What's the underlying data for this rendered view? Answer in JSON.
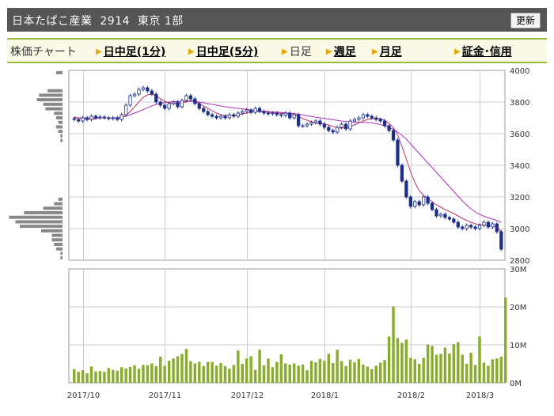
{
  "header": {
    "title": "日本たばこ産業  2914  東京 1部",
    "refresh_label": "更新"
  },
  "tabs": [
    {
      "label": "株価チャート",
      "style": "plain"
    },
    {
      "label": "日中足(1分)",
      "style": "link"
    },
    {
      "label": "日中足(5分)",
      "style": "link"
    },
    {
      "label": "日足",
      "style": "current"
    },
    {
      "label": "週足",
      "style": "link"
    },
    {
      "label": "月足",
      "style": "link"
    },
    {
      "label": "証金･信用",
      "style": "link"
    }
  ],
  "colors": {
    "up_candle": "#ffffff",
    "down_candle": "#1a2f8a",
    "ma_short": "#c0306a",
    "ma_long": "#b030c0",
    "volume_bar": "#8aac2c",
    "volume_profile": "#888888",
    "grid": "#cccccc"
  },
  "chart_data": [
    {
      "type": "candlestick",
      "title": "",
      "ylim": [
        2800,
        4000
      ],
      "y_ticks": [
        "4000",
        "3800",
        "3600",
        "3400",
        "3200",
        "3000",
        "2800"
      ],
      "x_ticks": [
        "2017/10",
        "2017/11",
        "2017/12",
        "2018/1",
        "2018/2",
        "2018/3"
      ],
      "close": [
        3690,
        3680,
        3700,
        3690,
        3710,
        3700,
        3705,
        3700,
        3695,
        3700,
        3690,
        3720,
        3780,
        3840,
        3850,
        3880,
        3890,
        3870,
        3850,
        3800,
        3780,
        3760,
        3790,
        3800,
        3770,
        3810,
        3840,
        3820,
        3790,
        3760,
        3740,
        3720,
        3710,
        3700,
        3710,
        3700,
        3720,
        3710,
        3730,
        3740,
        3750,
        3735,
        3760,
        3740,
        3730,
        3725,
        3730,
        3720,
        3715,
        3730,
        3700,
        3720,
        3650,
        3650,
        3660,
        3670,
        3680,
        3660,
        3640,
        3620,
        3610,
        3640,
        3660,
        3630,
        3680,
        3690,
        3700,
        3720,
        3710,
        3700,
        3690,
        3680,
        3650,
        3620,
        3560,
        3400,
        3300,
        3200,
        3140,
        3170,
        3150,
        3200,
        3160,
        3120,
        3080,
        3090,
        3070,
        3060,
        3040,
        3010,
        3000,
        3020,
        3010,
        3000,
        3020,
        3040,
        3010,
        3030,
        2980,
        2870
      ],
      "ma_short": [
        3705,
        3700,
        3695,
        3690,
        3690,
        3695,
        3700,
        3700,
        3700,
        3700,
        3698,
        3700,
        3715,
        3740,
        3770,
        3800,
        3830,
        3845,
        3850,
        3840,
        3820,
        3805,
        3795,
        3790,
        3790,
        3795,
        3800,
        3810,
        3805,
        3790,
        3775,
        3760,
        3745,
        3730,
        3720,
        3715,
        3715,
        3715,
        3720,
        3725,
        3730,
        3735,
        3740,
        3740,
        3738,
        3735,
        3733,
        3730,
        3728,
        3727,
        3722,
        3720,
        3710,
        3695,
        3685,
        3675,
        3668,
        3665,
        3662,
        3655,
        3645,
        3638,
        3635,
        3638,
        3645,
        3655,
        3668,
        3680,
        3690,
        3695,
        3698,
        3695,
        3685,
        3665,
        3640,
        3590,
        3520,
        3440,
        3360,
        3290,
        3240,
        3210,
        3190,
        3170,
        3150,
        3135,
        3120,
        3108,
        3095,
        3080,
        3065,
        3052,
        3040,
        3030,
        3025,
        3022,
        3020,
        3018,
        3010,
        2980
      ],
      "ma_long": [
        3700,
        3700,
        3700,
        3700,
        3700,
        3700,
        3700,
        3700,
        3700,
        3700,
        3700,
        3705,
        3710,
        3720,
        3730,
        3740,
        3752,
        3764,
        3776,
        3785,
        3792,
        3797,
        3800,
        3802,
        3803,
        3804,
        3805,
        3805,
        3804,
        3800,
        3795,
        3790,
        3785,
        3780,
        3775,
        3770,
        3767,
        3763,
        3760,
        3757,
        3754,
        3750,
        3747,
        3744,
        3742,
        3740,
        3738,
        3736,
        3734,
        3732,
        3730,
        3727,
        3723,
        3719,
        3714,
        3709,
        3704,
        3700,
        3696,
        3692,
        3688,
        3684,
        3680,
        3677,
        3675,
        3673,
        3672,
        3671,
        3670,
        3668,
        3664,
        3658,
        3650,
        3640,
        3628,
        3610,
        3590,
        3565,
        3535,
        3505,
        3475,
        3445,
        3415,
        3385,
        3355,
        3325,
        3295,
        3265,
        3235,
        3205,
        3175,
        3148,
        3125,
        3105,
        3090,
        3078,
        3068,
        3060,
        3052,
        3040
      ],
      "volume_profile": [
        1,
        1,
        3,
        4,
        5,
        5,
        10,
        20,
        22,
        25,
        18,
        9,
        4,
        2,
        0,
        0,
        0,
        0,
        0,
        0,
        0,
        0,
        0,
        0,
        0,
        0,
        1,
        1,
        2,
        3,
        2,
        3,
        4,
        8,
        9,
        12,
        11,
        7,
        0,
        0,
        0,
        3
      ]
    },
    {
      "type": "bar",
      "title": "",
      "ylim": [
        0,
        30
      ],
      "y_ticks": [
        "30M",
        "20M",
        "10M",
        "0M"
      ],
      "x_ticks": [
        "2017/10",
        "2017/11",
        "2017/12",
        "2018/1",
        "2018/2",
        "2018/3"
      ],
      "values": [
        3.6,
        2.9,
        3.3,
        2.5,
        4.3,
        3.0,
        3.1,
        2.9,
        3.9,
        3.4,
        3.2,
        4.1,
        3.8,
        4.2,
        4.6,
        3.7,
        4.7,
        4.6,
        5.1,
        4.4,
        6.9,
        4.5,
        5.8,
        6.4,
        7.0,
        7.6,
        8.9,
        5.7,
        5.1,
        5.5,
        4.4,
        5.5,
        5.5,
        4.5,
        5.2,
        4.4,
        3.7,
        4.7,
        8.5,
        5.0,
        6.4,
        7.0,
        3.4,
        8.7,
        4.6,
        6.4,
        4.1,
        5.5,
        7.5,
        5.1,
        4.8,
        5.1,
        4.5,
        4.8,
        3.3,
        5.8,
        5.4,
        6.3,
        5.8,
        7.6,
        5.2,
        8.7,
        5.7,
        4.4,
        6.1,
        5.4,
        6.3,
        4.8,
        4.3,
        3.6,
        4.5,
        5.3,
        6.0,
        12.2,
        20.1,
        11.8,
        10.5,
        11.4,
        6.6,
        6.2,
        5.0,
        6.6,
        10.1,
        9.7,
        7.4,
        7.6,
        9.3,
        7.7,
        10.2,
        10.7,
        7.4,
        5.0,
        7.9,
        4.7,
        12.2,
        5.3,
        4.5,
        6.2,
        6.4,
        6.9,
        22.4
      ]
    }
  ]
}
